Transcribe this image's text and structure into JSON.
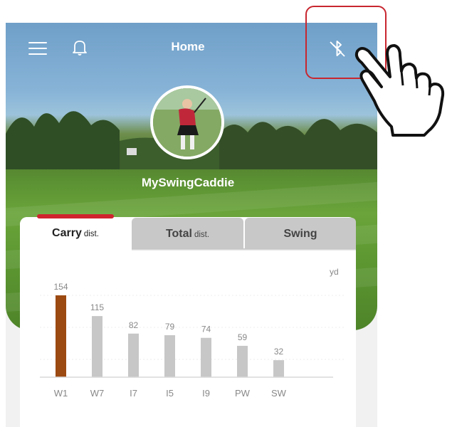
{
  "header": {
    "title": "Home",
    "menu_icon": "menu-icon",
    "notification_icon": "bell-icon",
    "bluetooth_icon": "bluetooth-disabled-icon"
  },
  "profile": {
    "username": "MySwingCaddie",
    "avatar": "profile-photo"
  },
  "tabs": [
    {
      "label": "Carry",
      "sub": "dist.",
      "active": true
    },
    {
      "label": "Total",
      "sub": "dist.",
      "active": false
    },
    {
      "label": "Swing",
      "sub": "",
      "active": false
    }
  ],
  "chart_data": {
    "type": "bar",
    "categories": [
      "W1",
      "W7",
      "I7",
      "I5",
      "I9",
      "PW",
      "SW"
    ],
    "values": [
      154,
      115,
      82,
      79,
      74,
      59,
      32
    ],
    "ylabel": "yd",
    "ylim": [
      0,
      154
    ],
    "highlight_index": 0,
    "colors": {
      "highlight": "#9c4a12",
      "default": "#c7c7c7",
      "label": "#888888",
      "axis": "#d9d9d9"
    }
  },
  "colors": {
    "accent": "#d0242e",
    "tab_inactive": "#c8c8c8"
  }
}
